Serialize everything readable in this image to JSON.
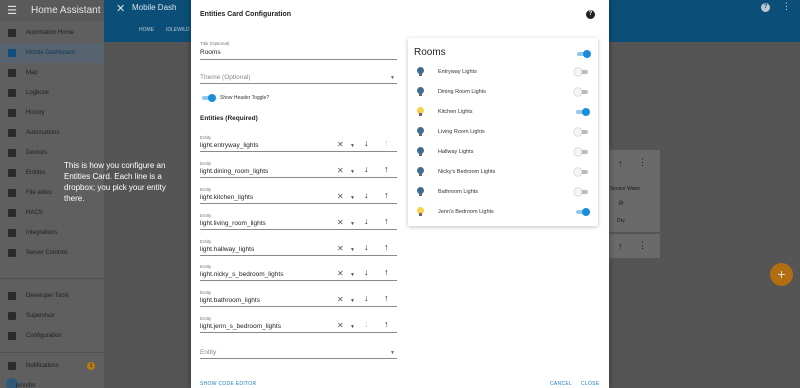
{
  "sidebar": {
    "app_title": "Home Assistant",
    "items": [
      {
        "label": "Automation Home",
        "icon": "dashboard-icon",
        "active": false
      },
      {
        "label": "Mobile Dashboard",
        "icon": "dashboard-icon",
        "active": true
      },
      {
        "label": "Map",
        "icon": "map-icon",
        "active": false
      },
      {
        "label": "Logbook",
        "icon": "logbook-icon",
        "active": false
      },
      {
        "label": "History",
        "icon": "history-icon",
        "active": false
      },
      {
        "label": "Automations",
        "icon": "automation-icon",
        "active": false
      },
      {
        "label": "Devices",
        "icon": "devices-icon",
        "active": false
      },
      {
        "label": "Entities",
        "icon": "entities-icon",
        "active": false
      },
      {
        "label": "File editor",
        "icon": "wrench-icon",
        "active": false
      },
      {
        "label": "HACS",
        "icon": "hacs-icon",
        "active": false
      },
      {
        "label": "Integrations",
        "icon": "puzzle-icon",
        "active": false
      },
      {
        "label": "Server Controls",
        "icon": "server-icon",
        "active": false
      }
    ],
    "bottom_items": [
      {
        "label": "Developer Tools",
        "icon": "hammer-icon"
      },
      {
        "label": "Supervisor",
        "icon": "supervisor-icon"
      },
      {
        "label": "Configuration",
        "icon": "gear-icon"
      },
      {
        "label": "Notifications",
        "icon": "bell-icon",
        "badge": "1"
      },
      {
        "label": "jennifer",
        "icon": "avatar-icon"
      }
    ]
  },
  "topbar": {
    "dashboard_title": "Mobile Dash",
    "tabs": [
      "HOME",
      "IDLEWILD"
    ],
    "help_glyph": "?"
  },
  "background": {
    "sensor_label": "re Sensor Water",
    "sensor_state": "Dry"
  },
  "annotation": "This is how you configure an Entities Card. Each line is a dropbox; you pick your entity there.",
  "dialog": {
    "title": "Entities Card Configuration",
    "help_glyph": "?",
    "title_field": {
      "label": "Title (Optional)",
      "value": "Rooms"
    },
    "theme_field": {
      "placeholder": "Theme (Optional)"
    },
    "show_header_toggle": {
      "label": "Show Header Toggle?",
      "on": true
    },
    "entities_header": "Entities (Required)",
    "entity_label": "Entity",
    "entities": [
      "light.entryway_lights",
      "light.dining_room_lights",
      "light.kitchen_lights",
      "light.living_room_lights",
      "light.hallway_lights",
      "light.nicky_s_bedroom_lights",
      "light.bathroom_lights",
      "light.jenn_s_bedroom_lights"
    ],
    "new_entity_placeholder": "Entity",
    "buttons": {
      "code_editor": "SHOW CODE EDITOR",
      "cancel": "CANCEL",
      "close": "CLOSE"
    }
  },
  "preview": {
    "title": "Rooms",
    "header_toggle_on": true,
    "rows": [
      {
        "label": "Entryway Lights",
        "on": false
      },
      {
        "label": "Dining Room Lights",
        "on": false
      },
      {
        "label": "Kitchen Lights",
        "on": true
      },
      {
        "label": "Living Room Lights",
        "on": false
      },
      {
        "label": "Hallway Lights",
        "on": false
      },
      {
        "label": "Nicky's Bedroom Lights",
        "on": false
      },
      {
        "label": "Bathroom Lights",
        "on": false
      },
      {
        "label": "Jenn's Bedroom Lights",
        "on": true
      }
    ]
  },
  "colors": {
    "accent": "#1a8ddb",
    "header_bg": "#0b4f78",
    "bulb_on": "#f6d24a",
    "bulb_off": "#3f6d93",
    "fab": "#b26f12"
  }
}
